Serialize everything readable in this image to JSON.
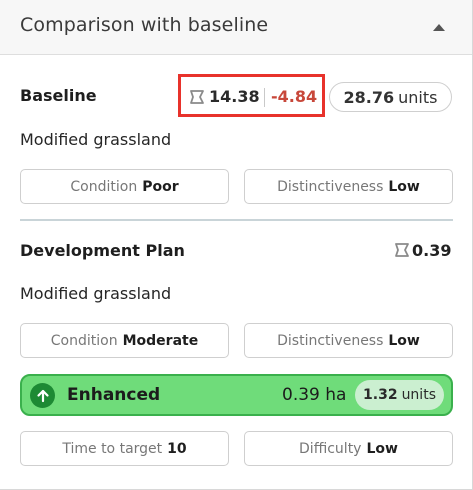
{
  "header": {
    "title": "Comparison with baseline"
  },
  "baseline": {
    "title": "Baseline",
    "area": "14.38",
    "area_diff": "-4.84",
    "units_value": "28.76",
    "units_label": "units",
    "habitat": "Modified grassland",
    "condition_label": "Condition",
    "condition_value": "Poor",
    "distinctiveness_label": "Distinctiveness",
    "distinctiveness_value": "Low"
  },
  "plan": {
    "title": "Development Plan",
    "area": "0.39",
    "habitat": "Modified grassland",
    "condition_label": "Condition",
    "condition_value": "Moderate",
    "distinctiveness_label": "Distinctiveness",
    "distinctiveness_value": "Low",
    "status_label": "Enhanced",
    "status_area": "0.39 ha",
    "status_units_value": "1.32",
    "status_units_label": "units",
    "time_label": "Time to target",
    "time_value": "10",
    "difficulty_label": "Difficulty",
    "difficulty_value": "Low"
  },
  "colors": {
    "highlight_border": "#e8322b",
    "negative": "#c8473a",
    "enhanced_bg": "#6fdc7a",
    "enhanced_icon": "#1d8a34"
  },
  "icons": [
    "chevron-up-icon",
    "area-polygon-icon",
    "arrow-up-icon"
  ]
}
